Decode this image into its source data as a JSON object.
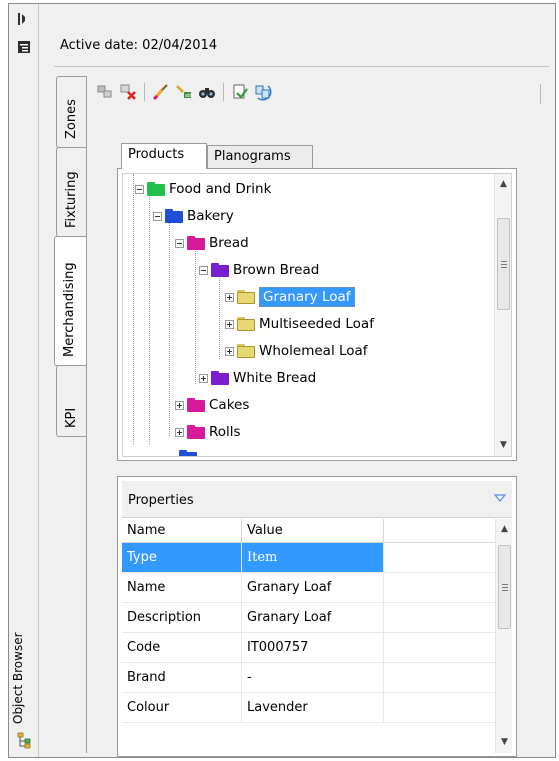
{
  "panel": {
    "title": "Object Browser",
    "active_date": "Active date: 02/04/2014"
  },
  "side_tabs": [
    {
      "label": "Zones"
    },
    {
      "label": "Fixturing"
    },
    {
      "label": "Merchandising",
      "active": true
    },
    {
      "label": "KPI"
    }
  ],
  "toolbar": {
    "buttons": [
      "add-item-icon",
      "delete-item-icon",
      "brush-icon",
      "find-replace-icon",
      "binoculars-icon",
      "export-icon",
      "refresh-icon"
    ]
  },
  "product_tabs": [
    {
      "label": "Products",
      "active": true
    },
    {
      "label": "Planograms"
    }
  ],
  "tree": {
    "nodes": [
      {
        "label": "Food and Drink",
        "color": "#22c04a",
        "level": 0,
        "expander": "minus"
      },
      {
        "label": "Bakery",
        "color": "#1f4fd8",
        "level": 1,
        "expander": "minus"
      },
      {
        "label": "Bread",
        "color": "#d6199a",
        "level": 2,
        "expander": "minus"
      },
      {
        "label": "Brown Bread",
        "color": "#7a1fd0",
        "level": 3,
        "expander": "minus"
      },
      {
        "label": "Granary Loaf",
        "color": "#e8d873",
        "level": 4,
        "expander": "plus",
        "selected": true
      },
      {
        "label": "Multiseeded Loaf",
        "color": "#e8d873",
        "level": 4,
        "expander": "plus"
      },
      {
        "label": "Wholemeal Loaf",
        "color": "#e8d873",
        "level": 4,
        "expander": "plus"
      },
      {
        "label": "White Bread",
        "color": "#7a1fd0",
        "level": 3,
        "expander": "plus"
      },
      {
        "label": "Cakes",
        "color": "#d6199a",
        "level": 2,
        "expander": "plus"
      },
      {
        "label": "Rolls",
        "color": "#d6199a",
        "level": 2,
        "expander": "plus"
      }
    ]
  },
  "properties": {
    "title": "Properties",
    "columns": [
      "Name",
      "Value"
    ],
    "rows": [
      {
        "name": "Type",
        "value": "Item",
        "selected": true
      },
      {
        "name": "Name",
        "value": "Granary Loaf"
      },
      {
        "name": "Description",
        "value": "Granary Loaf"
      },
      {
        "name": "Code",
        "value": "IT000757"
      },
      {
        "name": "Brand",
        "value": "-"
      },
      {
        "name": "Colour",
        "value": "Lavender"
      }
    ]
  }
}
